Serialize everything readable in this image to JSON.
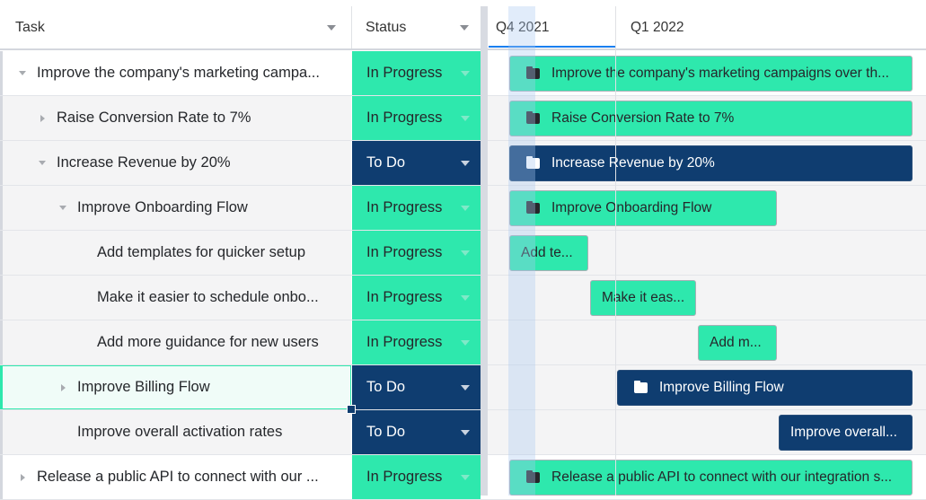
{
  "header": {
    "task": "Task",
    "status": "Status",
    "quarters": [
      "Q4 2021",
      "Q1 2022"
    ]
  },
  "colors": {
    "in_progress": "#2ee8ad",
    "to_do": "#0f3d70"
  },
  "rows": [
    {
      "task": "Improve the company's marketing campa...",
      "status": "In Progress",
      "bar": "Improve the company's marketing campaigns over th...",
      "expander": "expanded",
      "folder": true
    },
    {
      "task": "Raise Conversion Rate to 7%",
      "status": "In Progress",
      "bar": "Raise Conversion Rate to 7%",
      "expander": "collapsed",
      "folder": true
    },
    {
      "task": "Increase Revenue by 20%",
      "status": "To Do",
      "bar": "Increase Revenue by 20%",
      "expander": "expanded",
      "folder": true
    },
    {
      "task": "Improve Onboarding Flow",
      "status": "In Progress",
      "bar": "Improve Onboarding Flow",
      "expander": "expanded",
      "folder": true
    },
    {
      "task": "Add templates for quicker setup",
      "status": "In Progress",
      "bar": "Add te..."
    },
    {
      "task": "Make it easier to schedule onbo...",
      "status": "In Progress",
      "bar": "Make it eas..."
    },
    {
      "task": "Add more guidance for new users",
      "status": "In Progress",
      "bar": "Add m..."
    },
    {
      "task": "Improve Billing Flow",
      "status": "To Do",
      "bar": "Improve Billing Flow",
      "expander": "collapsed",
      "folder": true,
      "selected": true
    },
    {
      "task": "Improve overall activation rates",
      "status": "To Do",
      "bar": "Improve overall..."
    },
    {
      "task": "Release a public API to connect with our ...",
      "status": "In Progress",
      "bar": "Release a public API to connect with our integration s...",
      "expander": "collapsed",
      "folder": true
    }
  ]
}
